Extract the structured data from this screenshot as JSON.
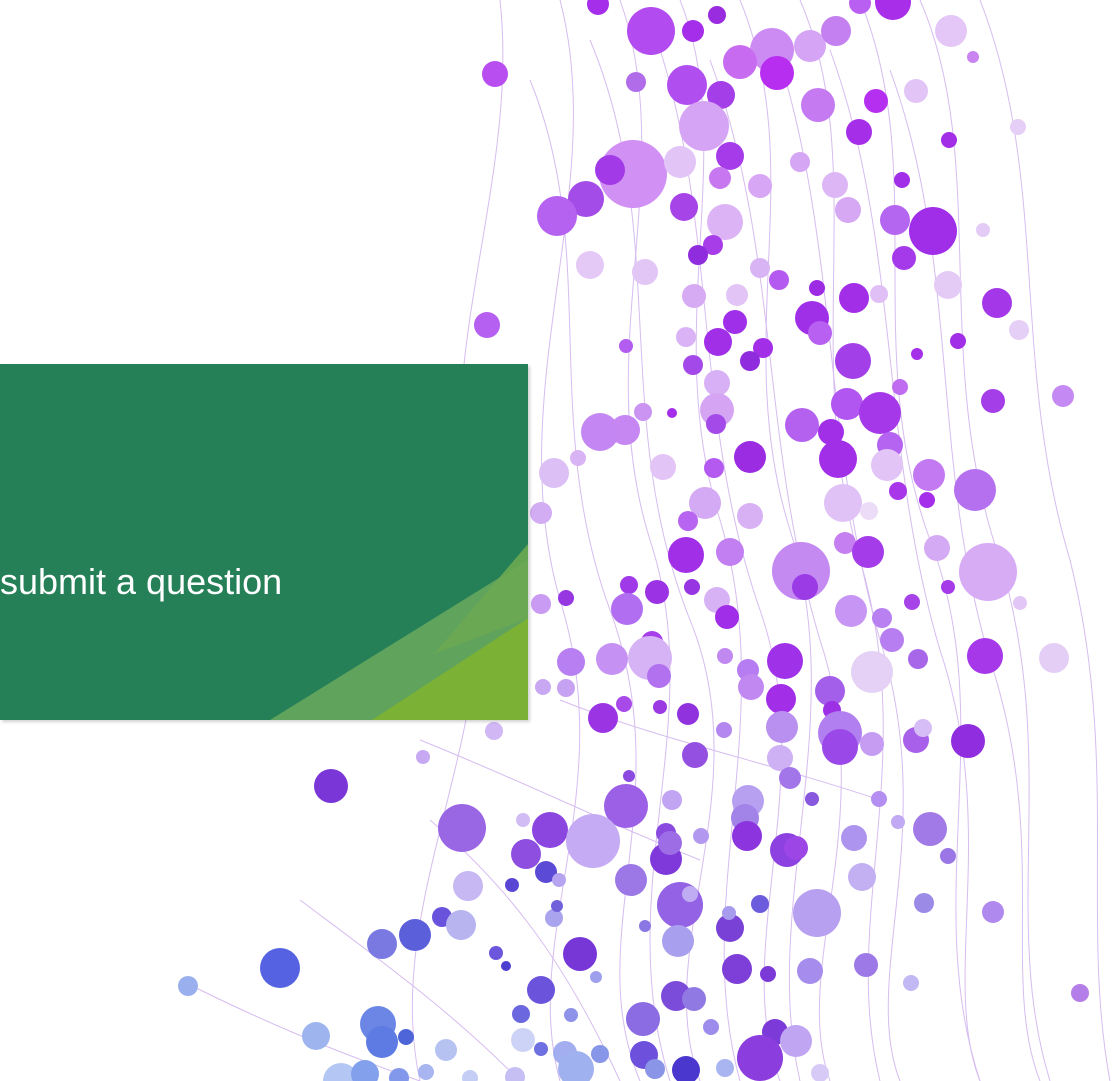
{
  "callout": {
    "text": "submit a question"
  },
  "colors": {
    "card_background": "#268057",
    "accent_light_green": "#5fa35d",
    "accent_lime": "#7bb135",
    "dot_purple": "#a42ee9",
    "dot_violet": "#8b50e8",
    "dot_lavender": "#d5aef3",
    "dot_blue": "#4b5de6",
    "thread_color": "#c7a3e8"
  },
  "decoration": {
    "style": "purple-network-dots"
  }
}
